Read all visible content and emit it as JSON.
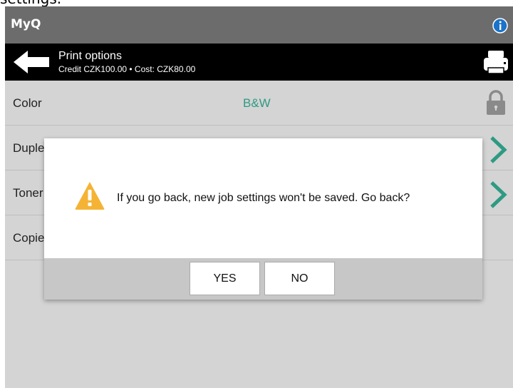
{
  "caption": "settings.",
  "titlebar": {
    "app_title": "MyQ"
  },
  "header": {
    "title": "Print options",
    "subtitle": "Credit CZK100.00 • Cost: CZK80.00"
  },
  "rows": [
    {
      "label": "Color",
      "value": "B&W",
      "icon": "lock-icon"
    },
    {
      "label": "Duplex",
      "icon": "chevron-right-icon"
    },
    {
      "label": "Toner",
      "icon": "chevron-right-icon"
    },
    {
      "label": "Copies"
    }
  ],
  "dialog": {
    "message": "If you go back, new job settings won't be saved. Go back?",
    "yes_label": "YES",
    "no_label": "NO"
  },
  "colors": {
    "titlebar": "#6c6c6c",
    "header": "#000000",
    "accent_teal": "#2e9a83",
    "info_blue": "#1a73c9",
    "warning_yellow": "#f5b335"
  }
}
